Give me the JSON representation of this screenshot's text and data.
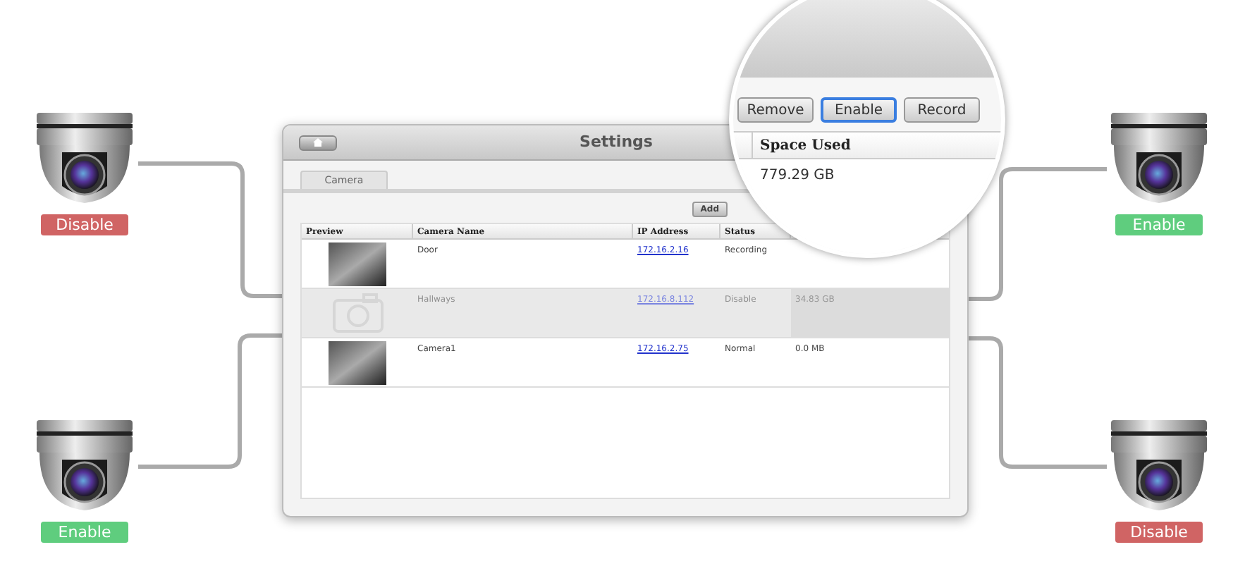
{
  "window": {
    "title": "Settings"
  },
  "tabs": [
    {
      "label": "Camera",
      "selected": true
    }
  ],
  "toolbar": {
    "buttons": [
      "Add"
    ]
  },
  "table": {
    "columns": [
      "Preview",
      "Camera Name",
      "IP Address",
      "Status"
    ],
    "rows": [
      {
        "name": "Door",
        "ip": "172.16.2.16",
        "status": "Recording",
        "disabled": false,
        "photo": true
      },
      {
        "name": "Hallways",
        "ip": "172.16.8.112",
        "status": "Disable",
        "space": "34.83 GB",
        "disabled": true,
        "photo": false
      },
      {
        "name": "Camera1",
        "ip": "172.16.2.75",
        "status": "Normal",
        "space": "0.0 MB",
        "disabled": false,
        "photo": true
      }
    ]
  },
  "magnifier": {
    "buttons": [
      {
        "label": "Remove",
        "selected": false
      },
      {
        "label": "Enable",
        "selected": true
      },
      {
        "label": "Record",
        "selected": false
      }
    ],
    "column": "Space Used",
    "value": "779.29 GB"
  },
  "cameras": [
    {
      "label": "Disable",
      "color": "#d06464"
    },
    {
      "label": "Enable",
      "color": "#5fcd7e"
    },
    {
      "label": "Enable",
      "color": "#5fcd7e"
    },
    {
      "label": "Disable",
      "color": "#d06464"
    }
  ]
}
